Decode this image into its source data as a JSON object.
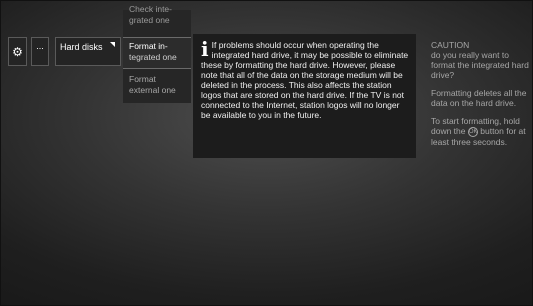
{
  "menu": {
    "settings_icon": "gear-icon",
    "more_label": "...",
    "hard_disks_label": "Hard disks"
  },
  "submenu": {
    "check_integrated_label_line1": "Check inte-",
    "check_integrated_label_line2": "grated one",
    "format_integrated_label_line1": "Format in-",
    "format_integrated_label_line2": "tegrated one",
    "format_external_label_line1": "Format",
    "format_external_label_line2": "external one"
  },
  "info": {
    "icon": "info-icon",
    "glyph": "i",
    "text": "If problems should occur when operating the integrated hard drive, it may be possible to eliminate these by formatting the hard drive. However, please note that all of the data on the storage medium will be deleted in the process. This also affects the station logos that are stored on the hard drive. If the TV is not connected to the Internet, station logos will no longer be available to you in the future."
  },
  "caution": {
    "title": "CAUTION",
    "question": "do you really want to format the integrated hard drive?",
    "warning": "Formatting deletes all the data on the hard drive.",
    "instruction_before": "To start formatting, hold down the",
    "button_glyph": "OK",
    "instruction_after": "button for at least three seconds."
  }
}
